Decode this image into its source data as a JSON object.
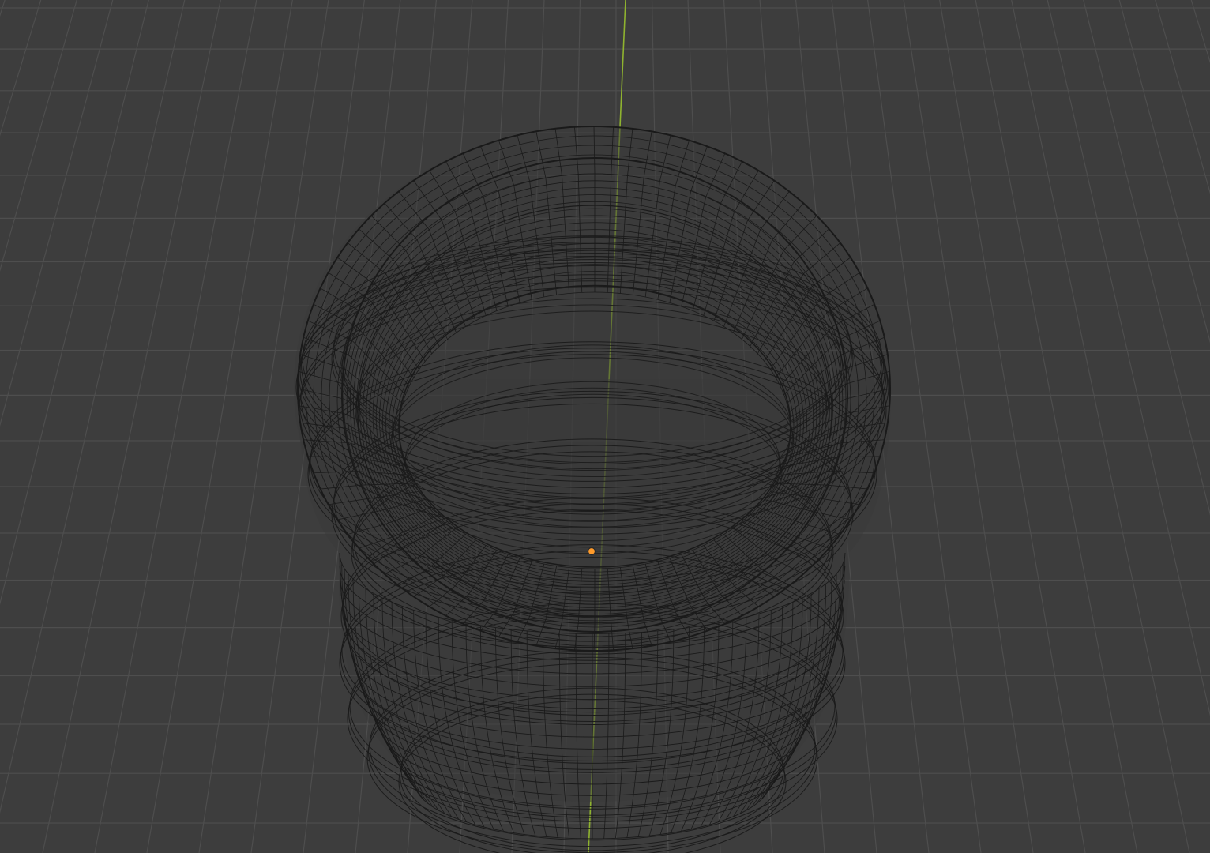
{
  "viewport": {
    "mode": "wireframe",
    "colors": {
      "background": "#3d3d3d",
      "grid_line": "#4e4e4e",
      "y_axis": "#8fb32f",
      "wire": "#1a1a1a",
      "pot_fill": "#3a3a3a",
      "origin_fill": "#ff9b2b",
      "origin_stroke": "#2a2a2a"
    },
    "icons": {
      "origin": "object-origin-icon"
    }
  }
}
